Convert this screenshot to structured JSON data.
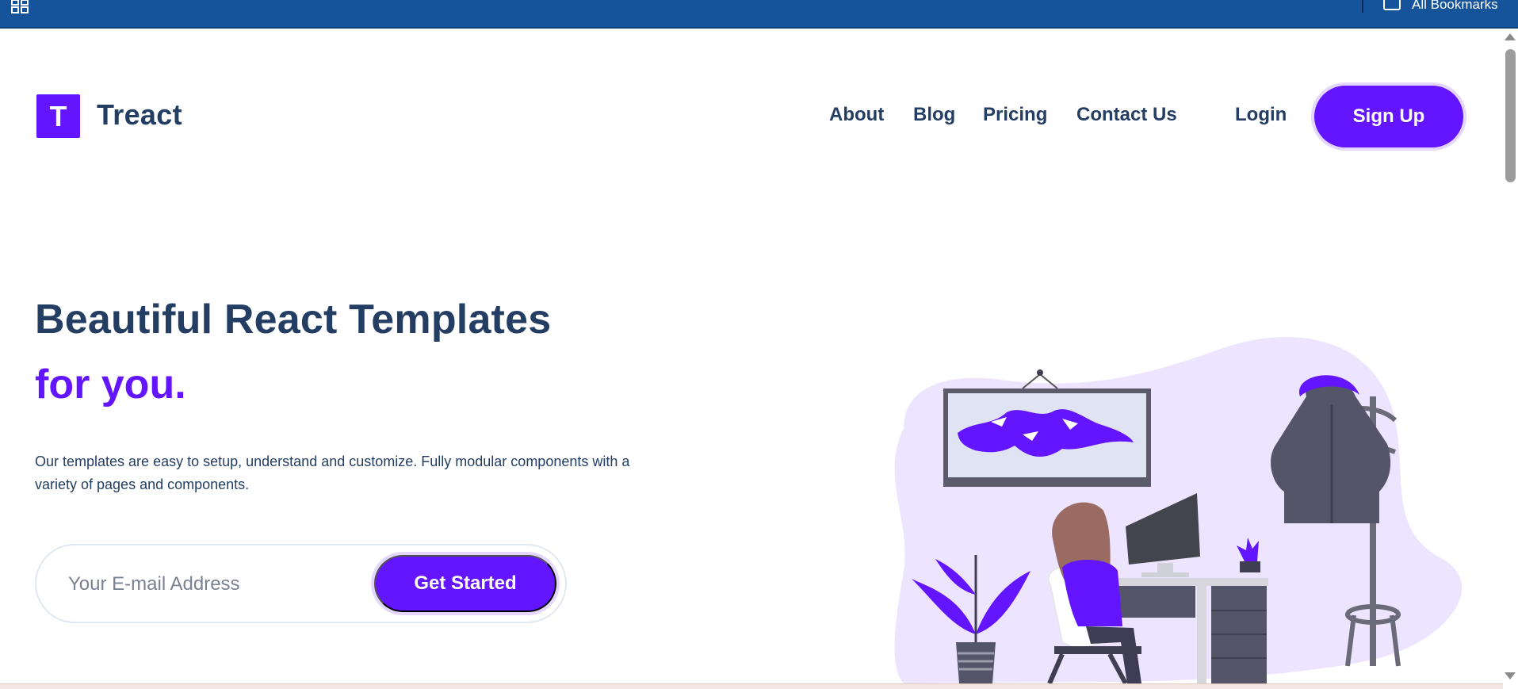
{
  "browser": {
    "bookmarks_label": "All Bookmarks",
    "bar_color": "#15549a"
  },
  "header": {
    "logo_letter": "T",
    "brand": "Treact",
    "nav": [
      "About",
      "Blog",
      "Pricing",
      "Contact Us"
    ],
    "login": "Login",
    "signup": "Sign Up"
  },
  "hero": {
    "title_line1": "Beautiful React Templates",
    "title_line2": "for you.",
    "description": "Our templates are easy to setup, understand and customize. Fully modular components with a variety of pages and components.",
    "email_placeholder": "Your E-mail Address",
    "cta": "Get Started"
  },
  "colors": {
    "accent": "#6415ff",
    "heading": "#243e63",
    "blob": "#ede5ff"
  },
  "icons": {
    "apps": "apps-grid-icon",
    "bookmark_folder": "folder-icon"
  }
}
